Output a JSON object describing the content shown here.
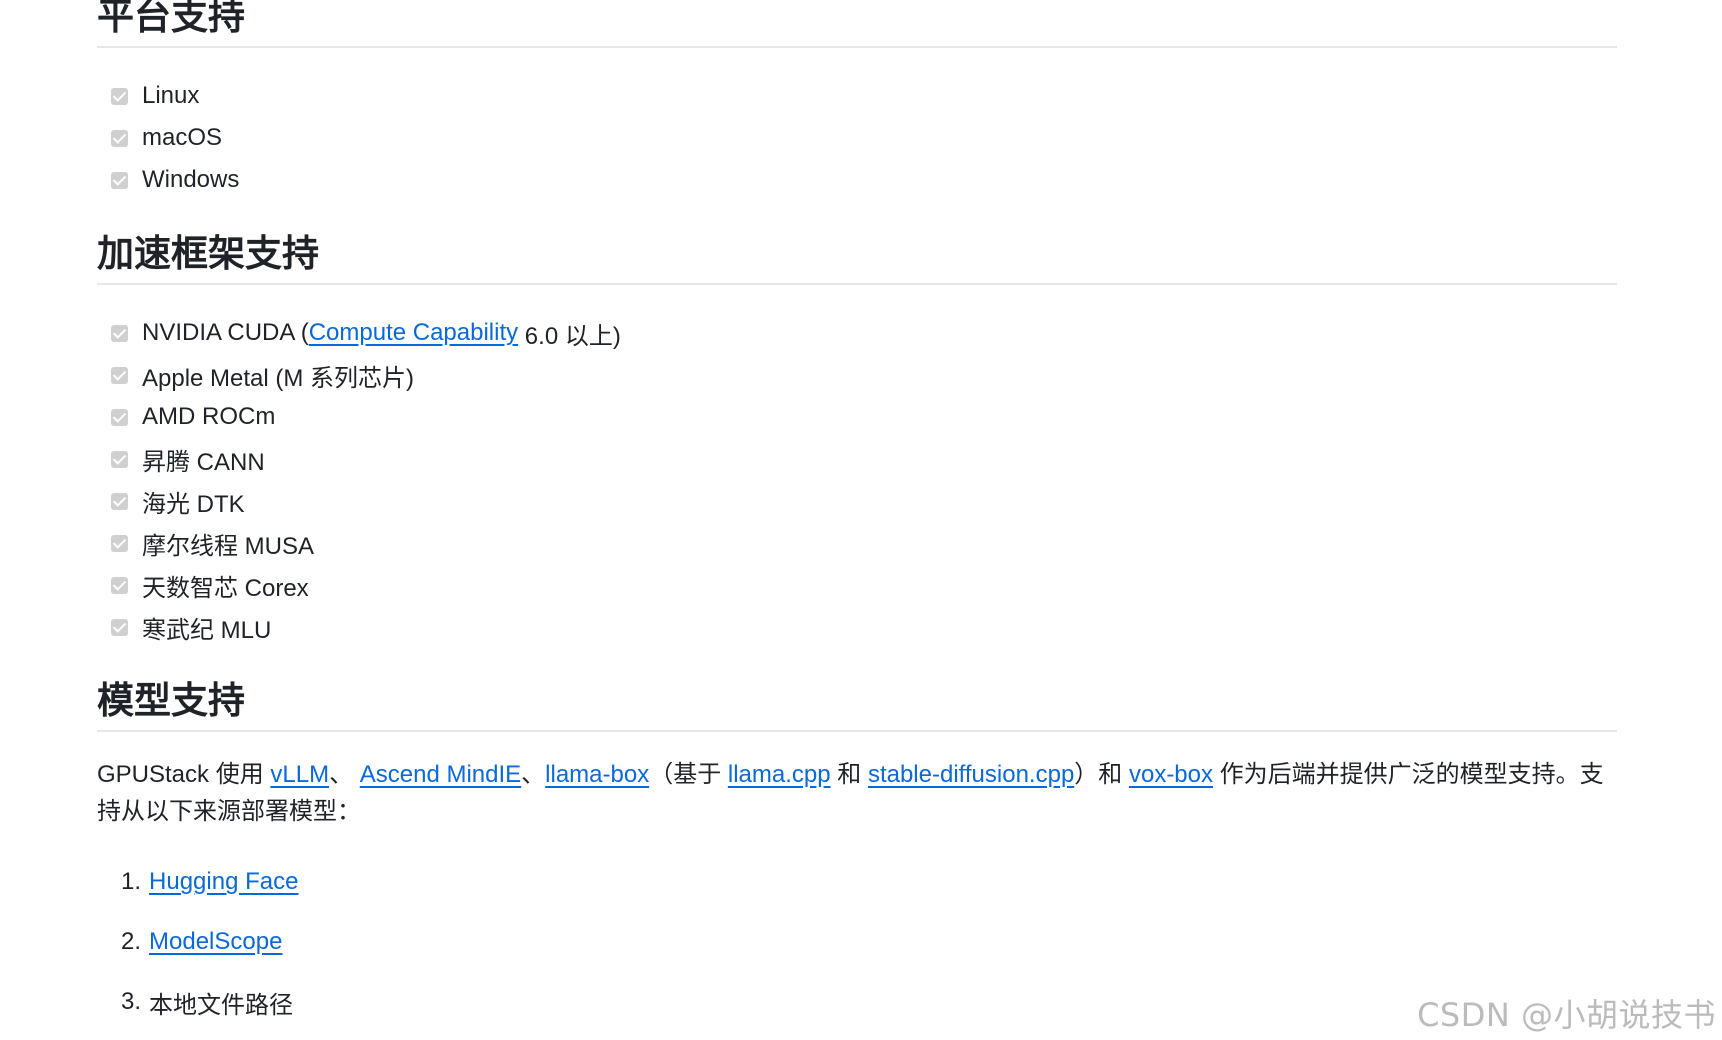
{
  "platform": {
    "heading": "平台支持",
    "items": [
      "Linux",
      "macOS",
      "Windows"
    ]
  },
  "accel": {
    "heading": "加速框架支持",
    "cuda": {
      "prefix": "NVIDIA CUDA (",
      "link": "Compute Capability",
      "suffix": " 6.0 以上)"
    },
    "items": [
      "Apple Metal (M 系列芯片)",
      "AMD ROCm",
      "昇腾 CANN",
      "海光 DTK",
      "摩尔线程 MUSA",
      "天数智芯 Corex",
      "寒武纪 MLU"
    ]
  },
  "models": {
    "heading": "模型支持",
    "desc": {
      "t1": "GPUStack 使用 ",
      "l1": "vLLM",
      "t2": "、 ",
      "l2": "Ascend MindIE",
      "t3": "、",
      "l3": "llama-box",
      "t4": "（基于 ",
      "l4": "llama.cpp",
      "t5": " 和 ",
      "l5": "stable-diffusion.cpp",
      "t6": "）和 ",
      "l6": "vox-box",
      "t7": " 作为后端并提供广泛的模型支持。支持从以下来源部署模型："
    },
    "sources": [
      {
        "num": "1.",
        "label": "Hugging Face",
        "link": true
      },
      {
        "num": "2.",
        "label": "ModelScope",
        "link": true
      },
      {
        "num": "3.",
        "label": "本地文件路径",
        "link": false
      }
    ]
  },
  "watermark": "CSDN @小胡说技书"
}
